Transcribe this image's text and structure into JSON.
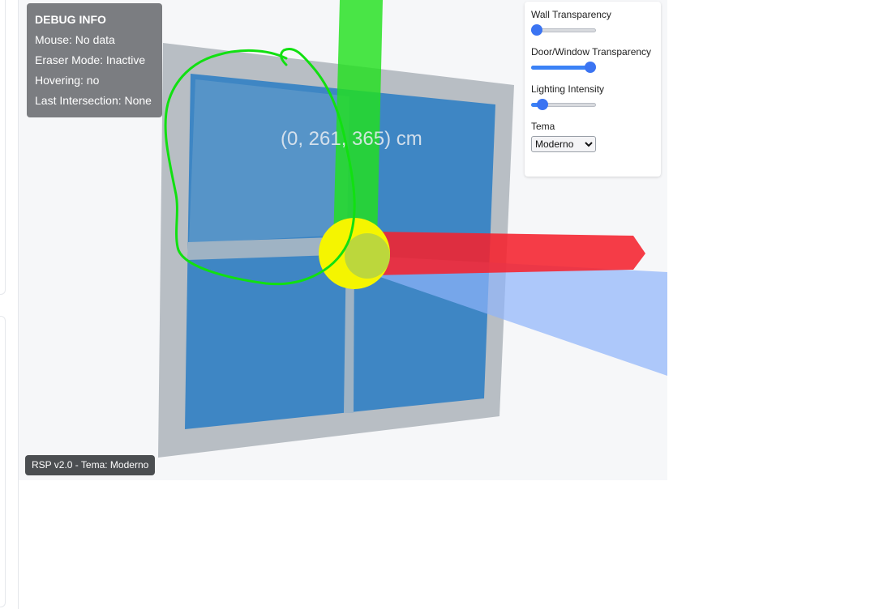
{
  "debug": {
    "title": "DEBUG INFO",
    "mouse": "Mouse: No data",
    "eraser_mode": "Eraser Mode: Inactive",
    "hovering": "Hovering: no",
    "last_intersection": "Last Intersection: None"
  },
  "scene": {
    "coordinate_label": "(0, 261, 365) cm"
  },
  "controls": {
    "wall_transparency": {
      "label": "Wall Transparency",
      "value": 0.0
    },
    "door_window_transparency": {
      "label": "Door/Window Transparency",
      "value": 1.0
    },
    "lighting_intensity": {
      "label": "Lighting Intensity",
      "value": 0.1
    },
    "theme": {
      "label": "Tema",
      "selected": "Moderno",
      "options": [
        "Moderno"
      ]
    }
  },
  "footer": {
    "version": "RSP v2.0 - Tema: Moderno"
  },
  "colors": {
    "x_axis": "#f5222d",
    "y_axis": "#22e01e",
    "z_axis": "#8fb3fb",
    "origin_marker": "#f5f500",
    "window_glass": "#3d86c6",
    "window_frame": "#b6bcc3",
    "slider_accent": "#3b74f2",
    "annotation_stroke": "#11e011"
  }
}
